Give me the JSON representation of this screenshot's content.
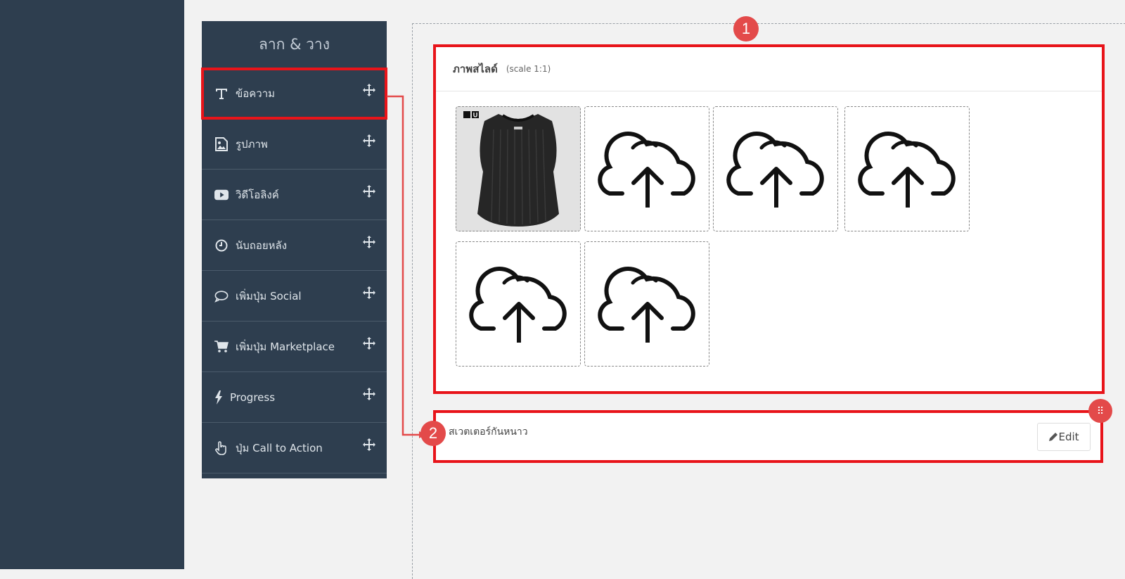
{
  "palette": {
    "title": "ลาก & วาง",
    "items": [
      {
        "label": "ข้อความ",
        "icon": "text-icon"
      },
      {
        "label": "รูปภาพ",
        "icon": "image-icon"
      },
      {
        "label": "วิดีโอลิงค์",
        "icon": "youtube-icon"
      },
      {
        "label": "นับถอยหลัง",
        "icon": "clock-icon"
      },
      {
        "label": "เพิ่มปุ่ม Social",
        "icon": "comment-icon"
      },
      {
        "label": "เพิ่มปุ่ม Marketplace",
        "icon": "cart-icon"
      },
      {
        "label": "Progress",
        "icon": "bolt-icon"
      },
      {
        "label": "ปุ่ม Call to Action",
        "icon": "hand-pointer-icon"
      }
    ]
  },
  "slide": {
    "title": "ภาพสไลด์",
    "scale": "(scale 1:1)",
    "photo_alt": "black sweater vest",
    "upload_icon": "cloud-upload-icon"
  },
  "text_block": {
    "content": "สเวตเตอร์กันหนาว",
    "edit_label": "Edit"
  },
  "badges": {
    "one": "1",
    "two": "2"
  },
  "colors": {
    "sidebar": "#2e3e4f",
    "highlight": "#e8141a",
    "badge": "#e34a4a"
  }
}
